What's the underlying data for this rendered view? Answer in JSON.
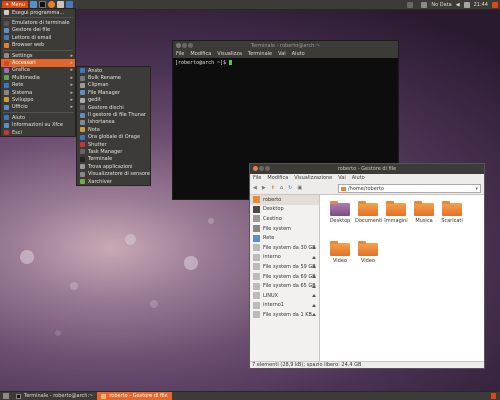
{
  "top_panel": {
    "menu_label": "Menu",
    "status_label": "No Data",
    "clock": "21:44"
  },
  "app_menu": {
    "items": [
      {
        "label": "Esegui programma...",
        "submenu": false,
        "selected": false
      },
      {
        "label": "Emulatore di terminale",
        "submenu": false,
        "selected": false
      },
      {
        "label": "Gestore dei file",
        "submenu": false,
        "selected": false
      },
      {
        "label": "Lettore di email",
        "submenu": false,
        "selected": false
      },
      {
        "label": "Browser web",
        "submenu": false,
        "selected": false
      },
      {
        "label": "Settings",
        "submenu": true,
        "selected": false
      },
      {
        "label": "Accessori",
        "submenu": true,
        "selected": true
      },
      {
        "label": "Grafica",
        "submenu": true,
        "selected": false
      },
      {
        "label": "Multimedia",
        "submenu": true,
        "selected": false
      },
      {
        "label": "Rete",
        "submenu": true,
        "selected": false
      },
      {
        "label": "Sistema",
        "submenu": true,
        "selected": false
      },
      {
        "label": "Sviluppo",
        "submenu": true,
        "selected": false
      },
      {
        "label": "Ufficio",
        "submenu": true,
        "selected": false
      },
      {
        "label": "Aiuto",
        "submenu": false,
        "selected": false
      },
      {
        "label": "Informazioni su Xfce",
        "submenu": false,
        "selected": false
      },
      {
        "label": "Esci",
        "submenu": false,
        "selected": false
      }
    ]
  },
  "accessori_menu": {
    "items": [
      "Ansto",
      "Bulk Rename",
      "Clipman",
      "File Manager",
      "gedit",
      "Gestore dischi",
      "Il gestore di file Thunar",
      "Ishortanea",
      "Nota",
      "Ora globale di Orage",
      "Shutter",
      "Task Manager",
      "Terminale",
      "Trova applicazioni",
      "Visualizzatore di sensore",
      "Xarchiver"
    ]
  },
  "terminal": {
    "title": "Terminale - roberto@arch:~",
    "menus": [
      "File",
      "Modifica",
      "Visualizza",
      "Terminale",
      "Vai",
      "Aiuto"
    ],
    "prompt": "[roberto@arch ~]$ "
  },
  "file_manager": {
    "title": "roberto - Gestore di file",
    "menus": [
      "File",
      "Modifica",
      "Visualizzazione",
      "Vai",
      "Aiuto"
    ],
    "path": "/home/roberto",
    "sidebar": [
      {
        "label": "roberto",
        "icon": "home-icon",
        "eject": false,
        "selected": true
      },
      {
        "label": "Desktop",
        "icon": "desktop-icon",
        "eject": false,
        "selected": false
      },
      {
        "label": "Cestino",
        "icon": "trash-icon",
        "eject": false,
        "selected": false
      },
      {
        "label": "File system",
        "icon": "filesystem-icon",
        "eject": false,
        "selected": false
      },
      {
        "label": "Rete",
        "icon": "network-icon",
        "eject": false,
        "selected": false
      },
      {
        "label": "File system da 30 GB",
        "icon": "drive-icon",
        "eject": true,
        "selected": false
      },
      {
        "label": "interno",
        "icon": "drive-icon",
        "eject": true,
        "selected": false
      },
      {
        "label": "File system da 59 GB",
        "icon": "drive-icon",
        "eject": true,
        "selected": false
      },
      {
        "label": "File system da 69 GB",
        "icon": "drive-icon",
        "eject": true,
        "selected": false
      },
      {
        "label": "File system da 65 GB",
        "icon": "drive-icon",
        "eject": true,
        "selected": false
      },
      {
        "label": "LINUX",
        "icon": "drive-icon",
        "eject": true,
        "selected": false
      },
      {
        "label": "interno1",
        "icon": "drive-icon",
        "eject": true,
        "selected": false
      },
      {
        "label": "File system da 1 KB",
        "icon": "drive-icon",
        "eject": true,
        "selected": false
      }
    ],
    "folders": [
      "Desktop",
      "Documenti",
      "Immagini",
      "Musica",
      "Scaricati",
      "Video",
      "Video"
    ],
    "status": "7 elementi (28,9 kB); spazio libero: 24,4 GB"
  },
  "taskbar": {
    "tasks": [
      {
        "label": "Terminale - roberto@arch:~",
        "active": false
      },
      {
        "label": "roberto - Gestore di file",
        "active": true
      }
    ]
  },
  "colors": {
    "accent": "#e0662c",
    "panel": "#3c3b37",
    "folder": "#f09a4a"
  }
}
